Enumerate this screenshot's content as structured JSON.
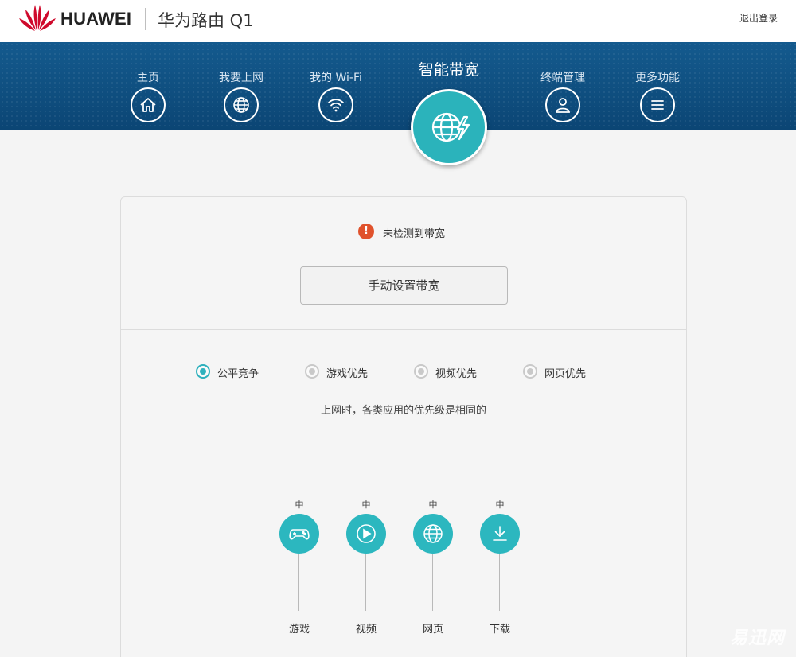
{
  "header": {
    "brand": "HUAWEI",
    "product": "华为路由 Q1",
    "logout": "退出登录",
    "brand_color": "#cf0a2c"
  },
  "nav": {
    "items": [
      {
        "label": "主页",
        "icon": "home-icon"
      },
      {
        "label": "我要上网",
        "icon": "globe-icon"
      },
      {
        "label": "我的 Wi-Fi",
        "icon": "wifi-icon"
      },
      {
        "label": "智能带宽",
        "icon": "globe-lightning-icon",
        "active": true
      },
      {
        "label": "终端管理",
        "icon": "user-icon"
      },
      {
        "label": "更多功能",
        "icon": "menu-icon"
      }
    ],
    "background_color": "#0f4f80",
    "active_color": "#2bb3bb"
  },
  "bandwidth": {
    "status_text": "未检测到带宽",
    "status_icon": "!",
    "manual_button": "手动设置带宽"
  },
  "modes": {
    "options": [
      {
        "label": "公平竞争",
        "selected": true
      },
      {
        "label": "游戏优先",
        "selected": false
      },
      {
        "label": "视频优先",
        "selected": false
      },
      {
        "label": "网页优先",
        "selected": false
      }
    ],
    "description": "上网时，各类应用的优先级是相同的"
  },
  "apps": [
    {
      "name": "游戏",
      "level": "中",
      "icon": "gamepad-icon"
    },
    {
      "name": "视频",
      "level": "中",
      "icon": "play-icon"
    },
    {
      "name": "网页",
      "level": "中",
      "icon": "globe-icon"
    },
    {
      "name": "下载",
      "level": "中",
      "icon": "download-icon"
    }
  ],
  "watermark": "易迅网"
}
